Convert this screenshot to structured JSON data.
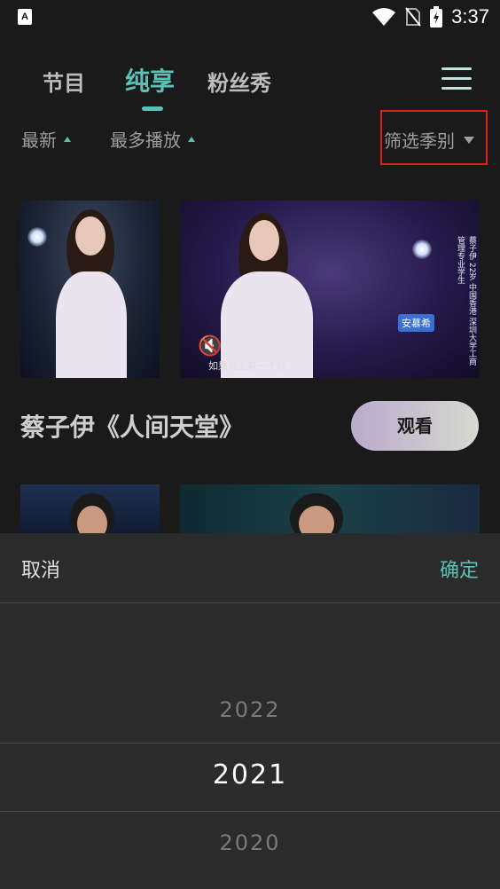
{
  "status_bar": {
    "time": "3:37",
    "app_badge": "A"
  },
  "tabs": [
    {
      "label": "节目",
      "active": false
    },
    {
      "label": "纯享",
      "active": true
    },
    {
      "label": "粉丝秀",
      "active": false
    }
  ],
  "sort": {
    "newest": "最新",
    "most_played": "最多播放",
    "filter": "筛选季别"
  },
  "video": {
    "title": "蔡子伊《人间天堂》",
    "watch_label": "观看",
    "caption": "如果世上有一个好",
    "badge_text": "安慕希",
    "vertical_text": "蔡子伊 22岁 中国香港 深圳大学工商管理专业学生"
  },
  "sheet": {
    "cancel": "取消",
    "confirm": "确定",
    "options": [
      "2022",
      "2021",
      "2020"
    ],
    "selected": "2021"
  },
  "colors": {
    "accent": "#5bc0b6",
    "highlight_box": "#e02020",
    "background": "#1a1a1a",
    "sheet": "#2b2b2b"
  }
}
